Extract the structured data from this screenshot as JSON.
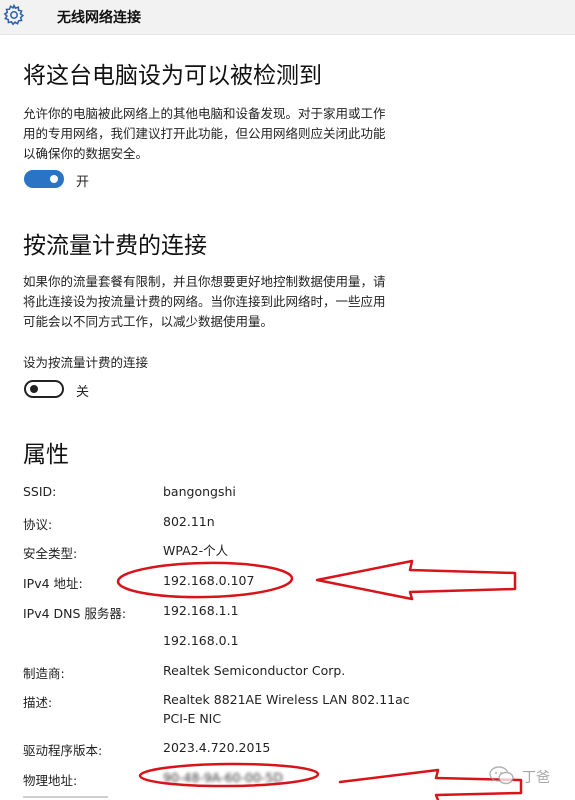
{
  "window": {
    "title": "无线网络连接",
    "icon": "gear-icon"
  },
  "discoverable": {
    "heading": "将这台电脑设为可以被检测到",
    "description": "允许你的电脑被此网络上的其他电脑和设备发现。对于家用或工作\n用的专用网络，我们建议打开此功能，但公用网络则应关闭此功能\n以确保你的数据安全。",
    "toggle_state": "开",
    "toggle_on": true
  },
  "metered": {
    "heading": "按流量计费的连接",
    "description": "如果你的流量套餐有限制，并且你想要更好地控制数据使用量，请\n将此连接设为按流量计费的网络。当你连接到此网络时，一些应用\n可能会以不同方式工作，以减少数据使用量。",
    "setting_label": "设为按流量计费的连接",
    "toggle_state": "关",
    "toggle_on": false
  },
  "properties": {
    "heading": "属性",
    "ssid_label": "SSID:",
    "ssid_value": "bangongshi",
    "protocol_label": "协议:",
    "protocol_value": "802.11n",
    "security_label": "安全类型:",
    "security_value": "WPA2-个人",
    "ipv4_label": "IPv4 地址:",
    "ipv4_value": "192.168.0.107",
    "dns_label": "IPv4 DNS 服务器:",
    "dns_value_1": "192.168.1.1",
    "dns_value_2": "192.168.0.1",
    "manufacturer_label": "制造商:",
    "manufacturer_value": "Realtek Semiconductor Corp.",
    "description_label": "描述:",
    "description_value_line1": "Realtek 8821AE Wireless LAN 802.11ac",
    "description_value_line2": "PCI-E NIC",
    "driver_label": "驱动程序版本:",
    "driver_value": "2023.4.720.2015",
    "mac_label": "物理地址:",
    "mac_value": "90-48-9A-60-00-5D"
  },
  "annotations": {
    "color": "#d8141a"
  },
  "watermark": {
    "text": "丁爸"
  }
}
